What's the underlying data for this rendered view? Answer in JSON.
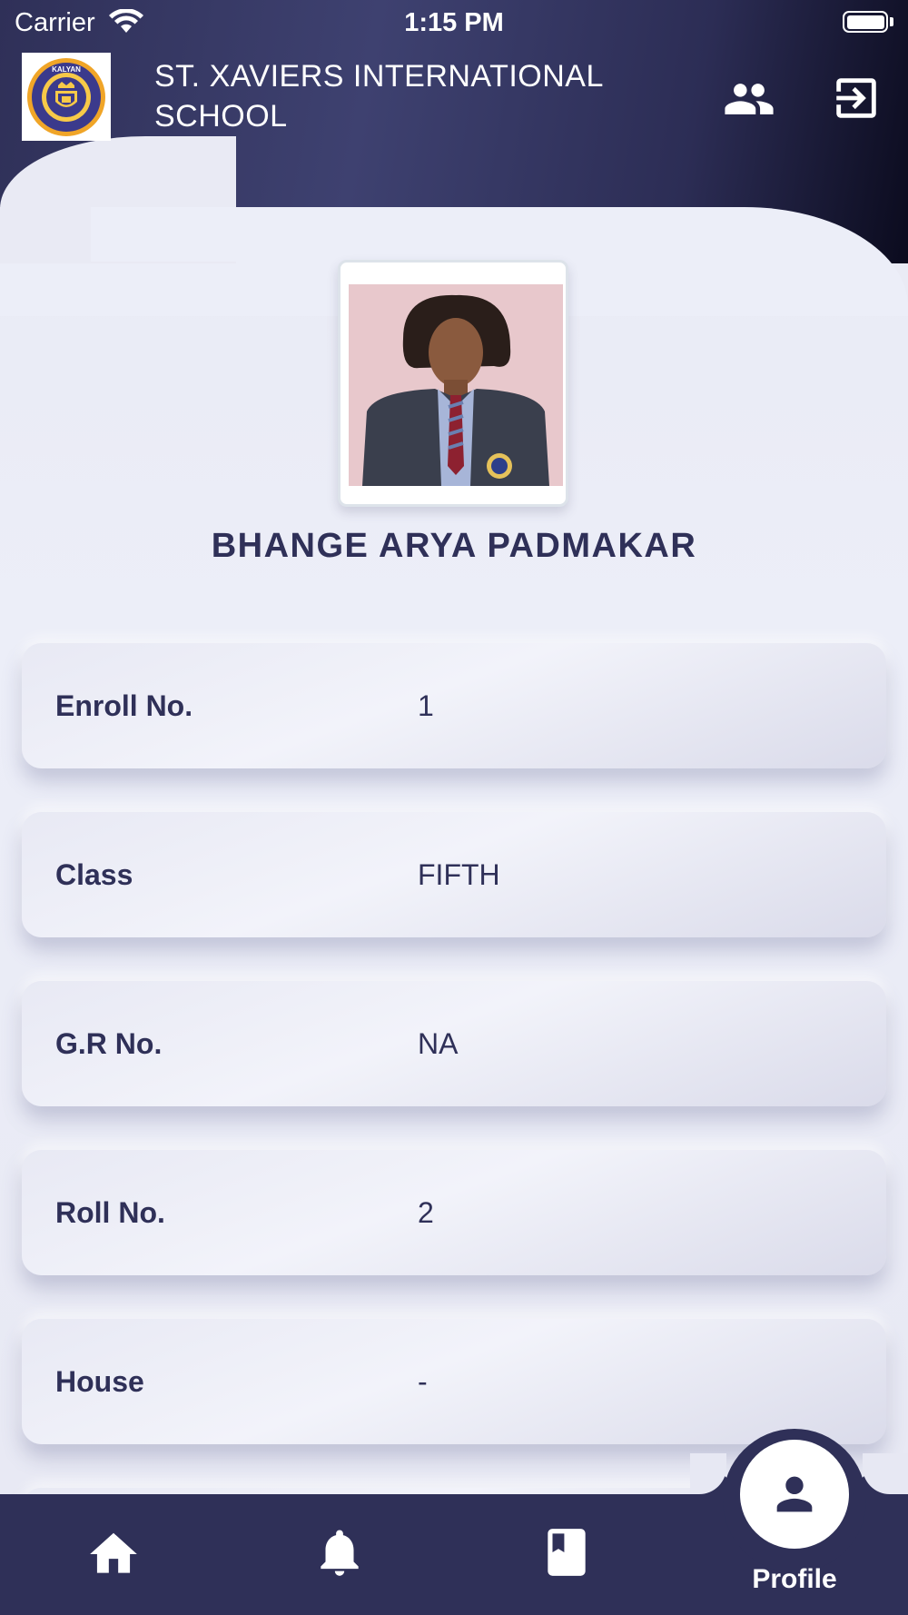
{
  "status_bar": {
    "carrier": "Carrier",
    "time": "1:15 PM"
  },
  "header": {
    "school_name": "ST. XAVIERS INTERNATIONAL SCHOOL",
    "logo_text_top": "KALYAN",
    "logo_text_ring": "ST.XAVIERS INTERNATIONAL SCHOOL",
    "icons": [
      "people-icon",
      "logout-icon"
    ]
  },
  "profile": {
    "name": "BHANGE ARYA PADMAKAR",
    "fields": [
      {
        "label": "Enroll No.",
        "value": "1"
      },
      {
        "label": "Class",
        "value": "FIFTH"
      },
      {
        "label": "G.R No.",
        "value": "NA"
      },
      {
        "label": "Roll No.",
        "value": "2"
      },
      {
        "label": "House",
        "value": "-"
      }
    ]
  },
  "bottom_nav": {
    "items": [
      {
        "icon": "home-icon"
      },
      {
        "icon": "bell-icon"
      },
      {
        "icon": "book-icon"
      },
      {
        "icon": "person-icon",
        "label": "Profile",
        "active": true
      }
    ]
  },
  "colors": {
    "primary": "#2f3058",
    "background": "#eceef8",
    "white": "#ffffff"
  }
}
